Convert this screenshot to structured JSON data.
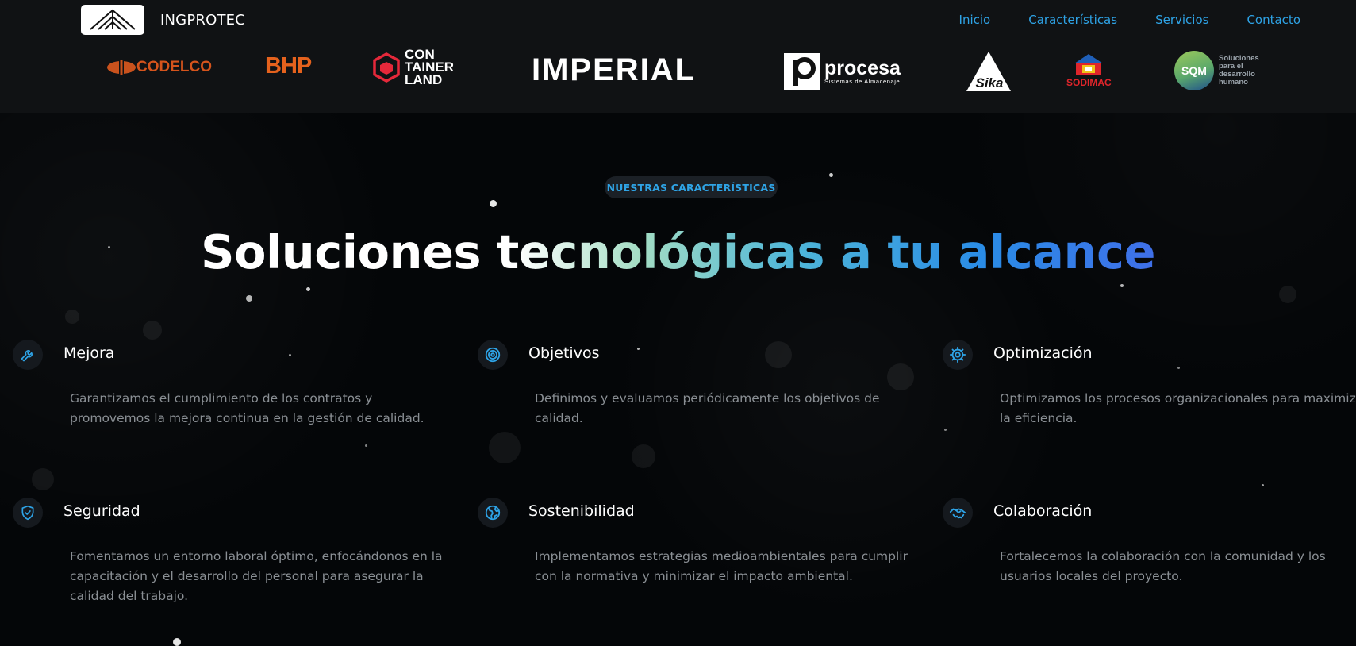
{
  "brand": {
    "name": "INGPROTEC"
  },
  "nav": [
    {
      "label": "Inicio"
    },
    {
      "label": "Características"
    },
    {
      "label": "Servicios"
    },
    {
      "label": "Contacto"
    }
  ],
  "clients": {
    "codelco": "CODELCO",
    "bhp": "BHP",
    "container_l1": "CON",
    "container_l2": "TAINER",
    "container_l3": "LAND",
    "imperial": "IMPERIAL",
    "procesa": "procesa",
    "procesa_sub": "Sistemas de Almacenaje",
    "sika": "Sika",
    "sodimac": "SODIMAC",
    "sqm": "SQM",
    "sqm_l1": "Soluciones",
    "sqm_l2": "para el",
    "sqm_l3": "desarrollo",
    "sqm_l4": "humano"
  },
  "section": {
    "badge": "NUESTRAS CARACTERÍSTICAS",
    "headline": "Soluciones tecnológicas a tu alcance"
  },
  "features": [
    {
      "icon": "wrench-icon",
      "title": "Mejora",
      "desc": "Garantizamos el cumplimiento de los contratos y promovemos la mejora continua en la gestión de calidad."
    },
    {
      "icon": "target-icon",
      "title": "Objetivos",
      "desc": "Definimos y evaluamos periódicamente los objetivos de calidad."
    },
    {
      "icon": "gear-icon",
      "title": "Optimización",
      "desc": "Optimizamos los procesos organizacionales para maximizar la eficiencia."
    },
    {
      "icon": "shield-check-icon",
      "title": "Seguridad",
      "desc": "Fomentamos un entorno laboral óptimo, enfocándonos en la capacitación y el desarrollo del personal para asegurar la calidad del trabajo."
    },
    {
      "icon": "globe-icon",
      "title": "Sostenibilidad",
      "desc": "Implementamos estrategias medioambientales para cumplir con la normativa y minimizar el impacto ambiental."
    },
    {
      "icon": "handshake-icon",
      "title": "Colaboración",
      "desc": "Fortalecemos la colaboración con la comunidad y los usuarios locales del proyecto."
    }
  ],
  "colors": {
    "accent": "#2ea3e6",
    "background": "#040608",
    "header": "#101214"
  }
}
